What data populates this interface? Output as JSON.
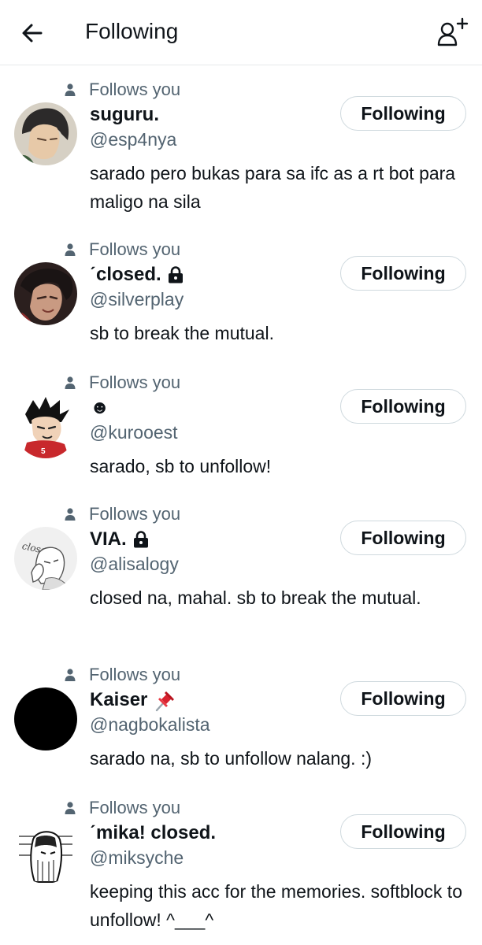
{
  "header": {
    "title": "Following",
    "back_icon": "arrow-left-icon",
    "add_icon": "add-user-icon"
  },
  "colors": {
    "text": "#0f1419",
    "secondary": "#536471",
    "border": "#cfd9de"
  },
  "users": [
    {
      "follows_label": "Follows you",
      "name": "suguru.",
      "handle": "@esp4nya",
      "bio": "sarado pero bukas para sa ifc as a rt bot para maligo na sila",
      "badge": "",
      "button_label": "Following"
    },
    {
      "follows_label": "Follows you",
      "name": "ˊclosed.",
      "handle": "@silverplay",
      "bio": "sb to break the mutual.",
      "badge": "lock-icon",
      "button_label": "Following"
    },
    {
      "follows_label": "Follows you",
      "name": "☻",
      "handle": "@kurooest",
      "bio": "sarado, sb to unfollow!",
      "badge": "",
      "button_label": "Following"
    },
    {
      "follows_label": "Follows you",
      "name": "VIA.",
      "handle": "@alisalogy",
      "bio": "closed na, mahal. sb to break the mutual.",
      "badge": "lock-icon",
      "avatar_text": "closed",
      "button_label": "Following"
    },
    {
      "follows_label": "Follows you",
      "name": "Kaiser",
      "handle": "@nagbokalista",
      "bio": "sarado na, sb to unfollow nalang. :)",
      "badge": "pushpin-icon",
      "button_label": "Following"
    },
    {
      "follows_label": "Follows you",
      "name": "ˊmika! closed.",
      "handle": "@miksyche",
      "bio": "keeping this acc for the memories. softblock to unfollow! ^___^",
      "badge": "",
      "button_label": "Following"
    }
  ]
}
